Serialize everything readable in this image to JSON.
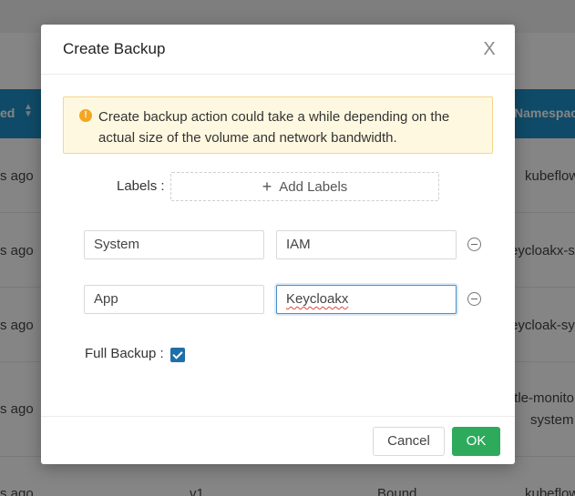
{
  "background": {
    "header_left": "ed",
    "header_right": "Namespace",
    "rows": [
      {
        "left": "s ago",
        "right": "kubeflow"
      },
      {
        "left": "s ago",
        "right": "eycloakx-sys"
      },
      {
        "left": "s ago",
        "right": "eycloak-sys"
      },
      {
        "left": "s ago",
        "right": "ttle-monitor",
        "right2": "system"
      },
      {
        "left": "s ago",
        "mid": "v1",
        "mid2": "Bound",
        "right": "kubeflow"
      }
    ]
  },
  "modal": {
    "title": "Create Backup",
    "close_glyph": "X",
    "alert_text": "Create backup action could take a while depending on the actual size of the volume and network bandwidth.",
    "labels_label": "Labels :",
    "add_labels_label": "Add Labels",
    "label_rows": [
      {
        "key": "System",
        "value": "IAM"
      },
      {
        "key": "App",
        "value": "Keycloakx"
      }
    ],
    "full_backup_label": "Full Backup :",
    "full_backup_checked": true,
    "cancel_label": "Cancel",
    "ok_label": "OK"
  },
  "colors": {
    "header_blue": "#1e90c8",
    "ok_green": "#2eaa5c",
    "alert_bg": "#fff8e1",
    "checkbox": "#1f6fa8"
  }
}
